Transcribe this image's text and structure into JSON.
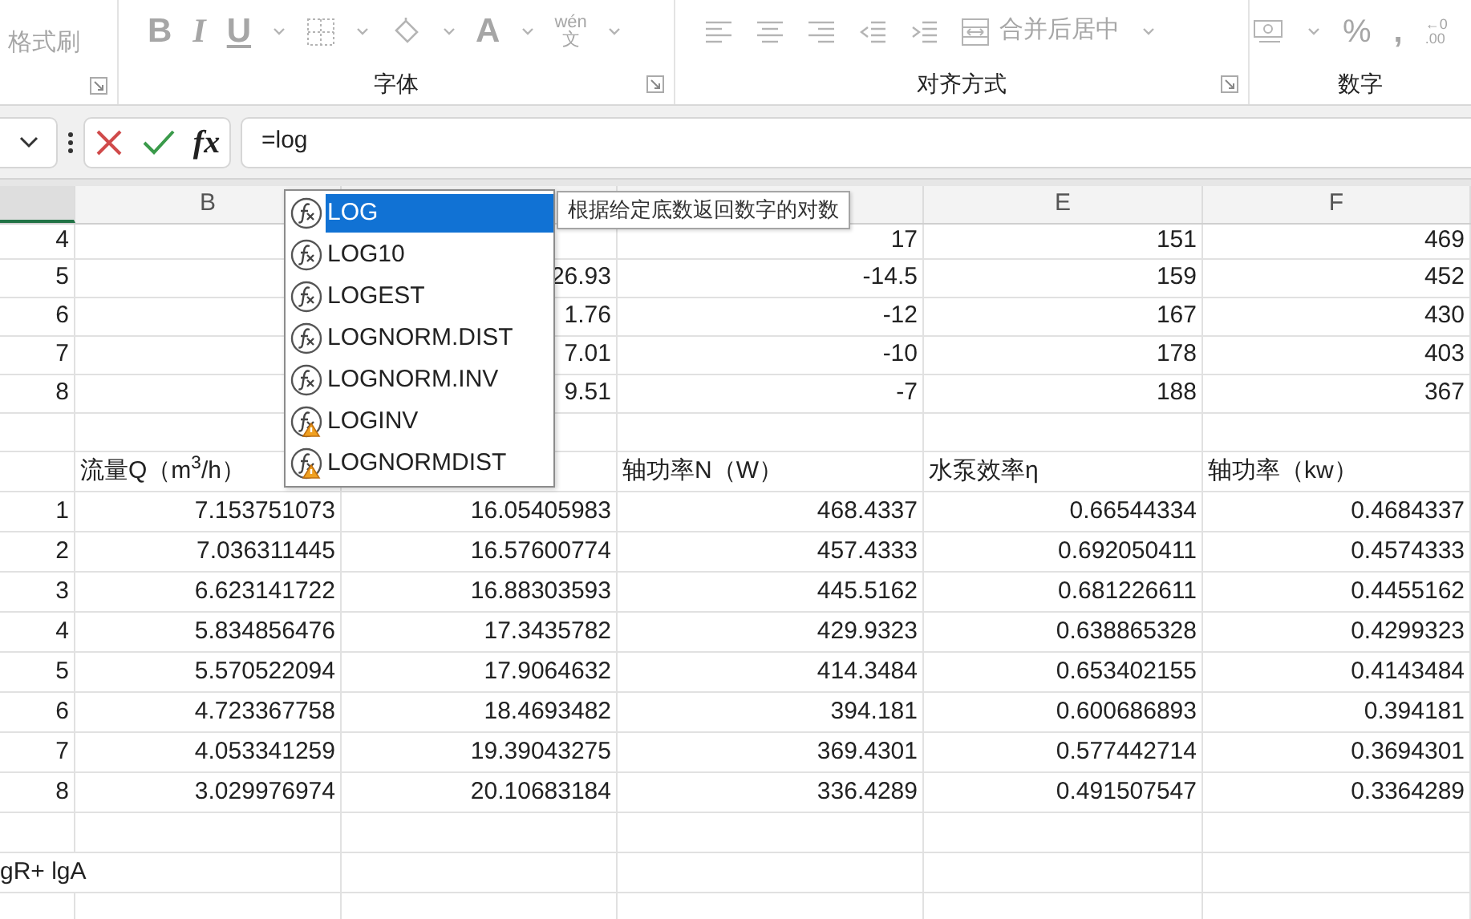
{
  "ribbon": {
    "disabled": true,
    "clipboard": {
      "format_painter": "格式刷"
    },
    "font": {
      "label": "字体",
      "bold": "B",
      "italic": "I",
      "underline": "U",
      "font_color": "A",
      "phonetic_top": "wén",
      "phonetic_bottom": "文"
    },
    "alignment": {
      "label": "对齐方式",
      "merge": "合并后居中"
    },
    "number": {
      "label": "数字",
      "percent": "%",
      "comma": ",",
      "decimal_top": "←0",
      "decimal_bottom": ".00"
    }
  },
  "formula_bar": {
    "fx": "fx",
    "formula": "=log"
  },
  "autocomplete": {
    "tooltip": "根据给定底数返回数字的对数",
    "items": [
      {
        "name": "LOG",
        "kind": "function",
        "selected": true
      },
      {
        "name": "LOG10",
        "kind": "function",
        "selected": false
      },
      {
        "name": "LOGEST",
        "kind": "function",
        "selected": false
      },
      {
        "name": "LOGNORM.DIST",
        "kind": "function",
        "selected": false
      },
      {
        "name": "LOGNORM.INV",
        "kind": "function",
        "selected": false
      },
      {
        "name": "LOGINV",
        "kind": "compatibility",
        "selected": false
      },
      {
        "name": "LOGNORMDIST",
        "kind": "compatibility",
        "selected": false
      }
    ]
  },
  "sheet": {
    "column_headers": [
      {
        "selected": true
      },
      {
        "letter": "B",
        "selected": false
      },
      {
        "selected": false
      },
      {
        "selected": false
      },
      {
        "letter": "E",
        "selected": false
      },
      {
        "letter": "F",
        "selected": false
      }
    ],
    "rows": [
      {
        "kind": "values",
        "cells": [
          "4",
          null,
          null,
          "17",
          "151",
          "469"
        ]
      },
      {
        "kind": "values",
        "cells": [
          "5",
          null,
          "26.93",
          "-14.5",
          "159",
          "452"
        ]
      },
      {
        "kind": "values",
        "cells": [
          "6",
          null,
          "1.76",
          "-12",
          "167",
          "430"
        ]
      },
      {
        "kind": "values",
        "cells": [
          "7",
          null,
          "7.01",
          "-10",
          "178",
          "403"
        ]
      },
      {
        "kind": "values",
        "cells": [
          "8",
          null,
          "9.51",
          "-7",
          "188",
          "367"
        ]
      },
      {
        "kind": "blank"
      },
      {
        "kind": "labels",
        "cells": [
          null,
          "流量Q（m$^{3}$/h）",
          null,
          "轴功率N（W）",
          "水泵效率η",
          "轴功率（kw）"
        ]
      },
      {
        "kind": "values",
        "cells": [
          "1",
          "7.153751073",
          "16.05405983",
          "468.4337",
          "0.66544334",
          "0.4684337"
        ]
      },
      {
        "kind": "values",
        "cells": [
          "2",
          "7.036311445",
          "16.57600774",
          "457.4333",
          "0.692050411",
          "0.4574333"
        ]
      },
      {
        "kind": "values",
        "cells": [
          "3",
          "6.623141722",
          "16.88303593",
          "445.5162",
          "0.681226611",
          "0.4455162"
        ]
      },
      {
        "kind": "values",
        "cells": [
          "4",
          "5.834856476",
          "17.3435782",
          "429.9323",
          "0.638865328",
          "0.4299323"
        ]
      },
      {
        "kind": "values",
        "cells": [
          "5",
          "5.570522094",
          "17.9064632",
          "414.3484",
          "0.653402155",
          "0.4143484"
        ]
      },
      {
        "kind": "values",
        "cells": [
          "6",
          "4.723367758",
          "18.4693482",
          "394.181",
          "0.600686893",
          "0.394181"
        ]
      },
      {
        "kind": "values",
        "cells": [
          "7",
          "4.053341259",
          "19.39043275",
          "369.4301",
          "0.577442714",
          "0.3694301"
        ]
      },
      {
        "kind": "values",
        "cells": [
          "8",
          "3.029976974",
          "20.10683184",
          "336.4289",
          "0.491507547",
          "0.3364289"
        ]
      },
      {
        "kind": "blank"
      },
      {
        "kind": "note",
        "text": "gR+ lgA"
      },
      {
        "kind": "blank"
      }
    ]
  }
}
